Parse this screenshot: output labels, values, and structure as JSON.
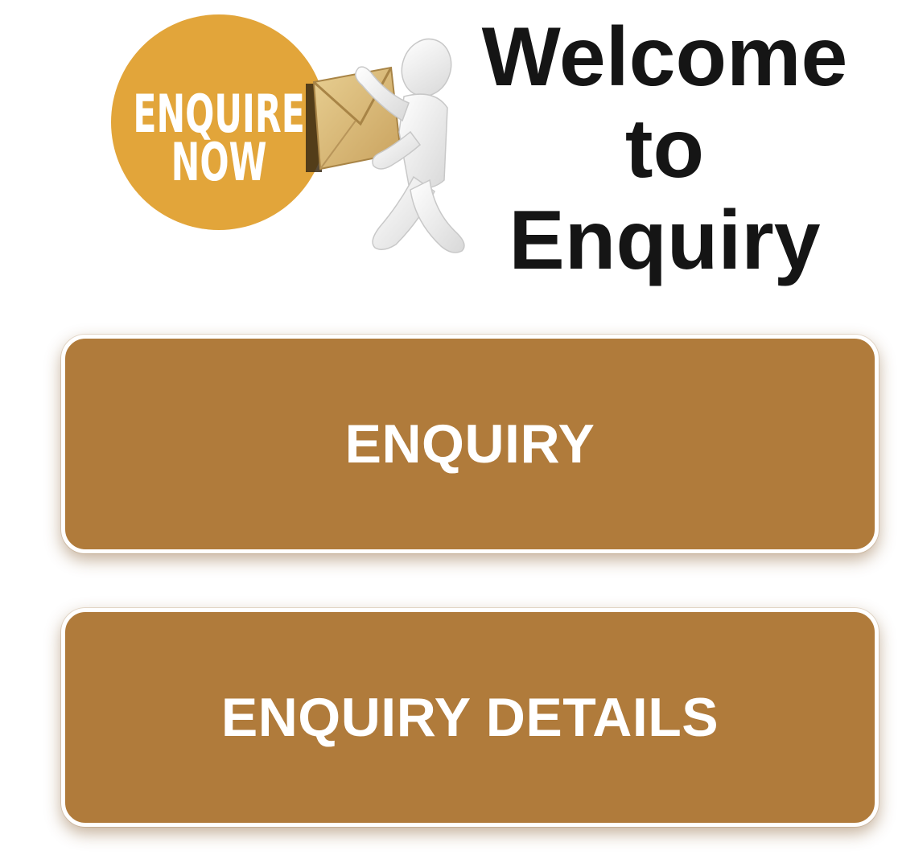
{
  "logo": {
    "badge_line1": "ENQUIRE",
    "badge_line2": "NOW",
    "badge_color": "#e2a53a",
    "icon": "enquire-now-figure-with-envelope"
  },
  "welcome": {
    "line1": "Welcome",
    "line2": "to",
    "line3": "Enquiry"
  },
  "buttons": {
    "enquiry": "ENQUIRY",
    "details": "ENQUIRY DETAILS",
    "color": "#b07b3b"
  }
}
